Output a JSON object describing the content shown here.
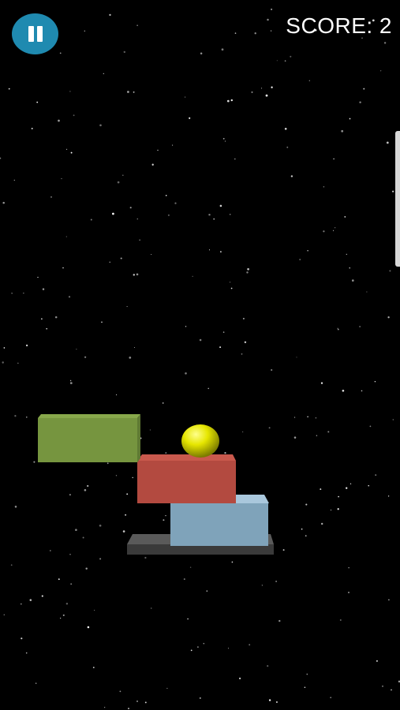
{
  "hud": {
    "score_label": "SCORE: 2",
    "pause_icon": "pause-icon",
    "pause_color": "#1f8ab0"
  },
  "scene": {
    "background_color": "#000000",
    "star_color": "#ffffff",
    "ball_color": "#e6e600",
    "blocks": [
      {
        "name": "base-platform",
        "color": "#4a4a4a"
      },
      {
        "name": "light-blue-block",
        "color": "#7fa3ba"
      },
      {
        "name": "red-block",
        "color": "#b34a40"
      },
      {
        "name": "green-block",
        "color": "#76953f"
      }
    ]
  }
}
